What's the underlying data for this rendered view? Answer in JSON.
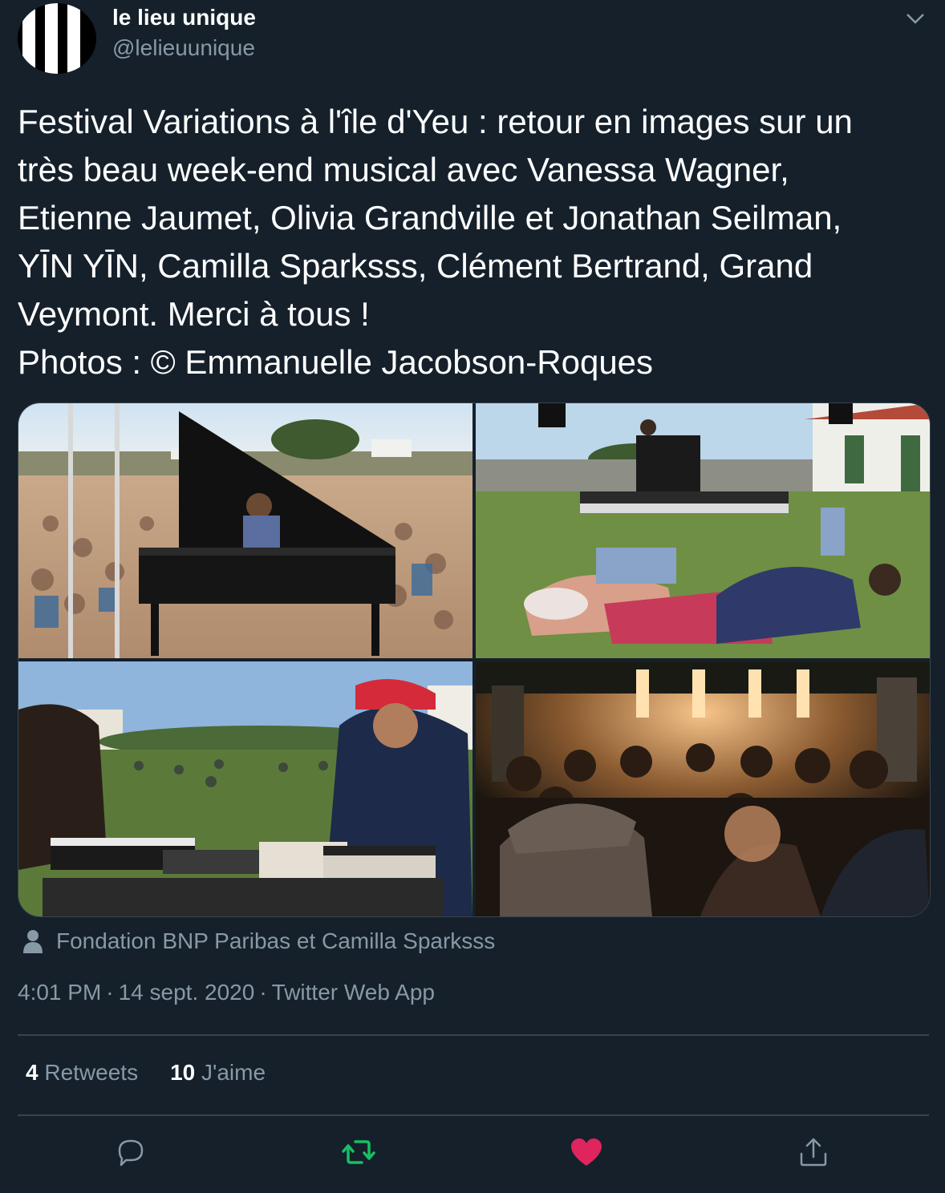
{
  "author": {
    "name": "le lieu unique",
    "handle": "@lelieuunique",
    "avatar_icon": "striped-logo-icon"
  },
  "tweet": {
    "lines": [
      "Festival Variations à l'île d'Yeu : retour en images sur un",
      "très beau week-end musical avec Vanessa Wagner,",
      "Etienne Jaumet, Olivia Grandville et Jonathan Seilman,",
      "YĪN YĪN, Camilla Sparksss, Clément Bertrand, Grand",
      "Veymont. Merci à tous !",
      "Photos : © Emmanuelle Jacobson-Roques"
    ]
  },
  "media": {
    "photos": [
      {
        "icon": "grand-piano-beach-photo"
      },
      {
        "icon": "stage-lawn-audience-photo"
      },
      {
        "icon": "synthesizer-performer-photo"
      },
      {
        "icon": "night-concert-crowd-photo"
      }
    ]
  },
  "tagged": {
    "icon": "person-icon",
    "text": "Fondation BNP Paribas et Camilla Sparksss"
  },
  "meta": {
    "time": "4:01 PM",
    "date": "14 sept. 2020",
    "source": "Twitter Web App",
    "separator": "·"
  },
  "stats": {
    "retweets_count": "4",
    "retweets_label": "Retweets",
    "likes_count": "10",
    "likes_label": "J'aime"
  },
  "actions": [
    {
      "icon": "reply-icon"
    },
    {
      "icon": "retweet-icon",
      "color": "#17bf63"
    },
    {
      "icon": "heart-icon",
      "color": "#e0245e"
    },
    {
      "icon": "share-icon"
    }
  ],
  "colors": {
    "background": "#15202b",
    "secondary_text": "#8899a6",
    "divider": "#38444d"
  }
}
